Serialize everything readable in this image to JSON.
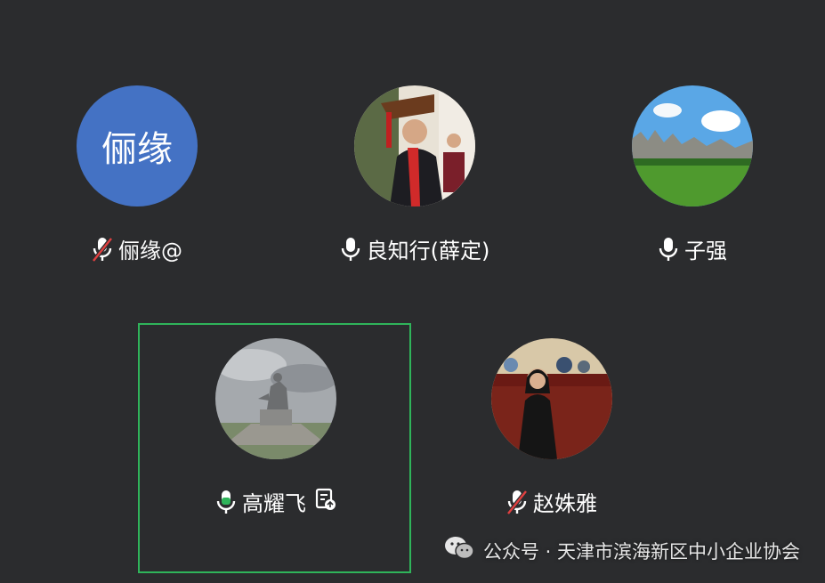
{
  "participants": [
    {
      "name": "俪缘@",
      "avatar_text": "俪缘",
      "mic": "muted"
    },
    {
      "name": "良知行(薛定)",
      "mic": "on"
    },
    {
      "name": "子强",
      "mic": "on"
    },
    {
      "name": "高耀飞",
      "mic": "speaking",
      "active_speaker": true
    },
    {
      "name": "赵姝雅",
      "mic": "muted"
    }
  ],
  "colors": {
    "background": "#2b2c2e",
    "avatar_blue": "#4472c4",
    "speaking_green": "#2fb45a",
    "muted_red": "#e04040"
  },
  "icons": {
    "mic": "mic-icon",
    "mic_muted": "mic-muted-icon",
    "screen_share": "screen-share-icon",
    "wechat": "wechat-icon"
  },
  "watermark": {
    "text": "公众号 · 天津市滨海新区中小企业协会"
  }
}
